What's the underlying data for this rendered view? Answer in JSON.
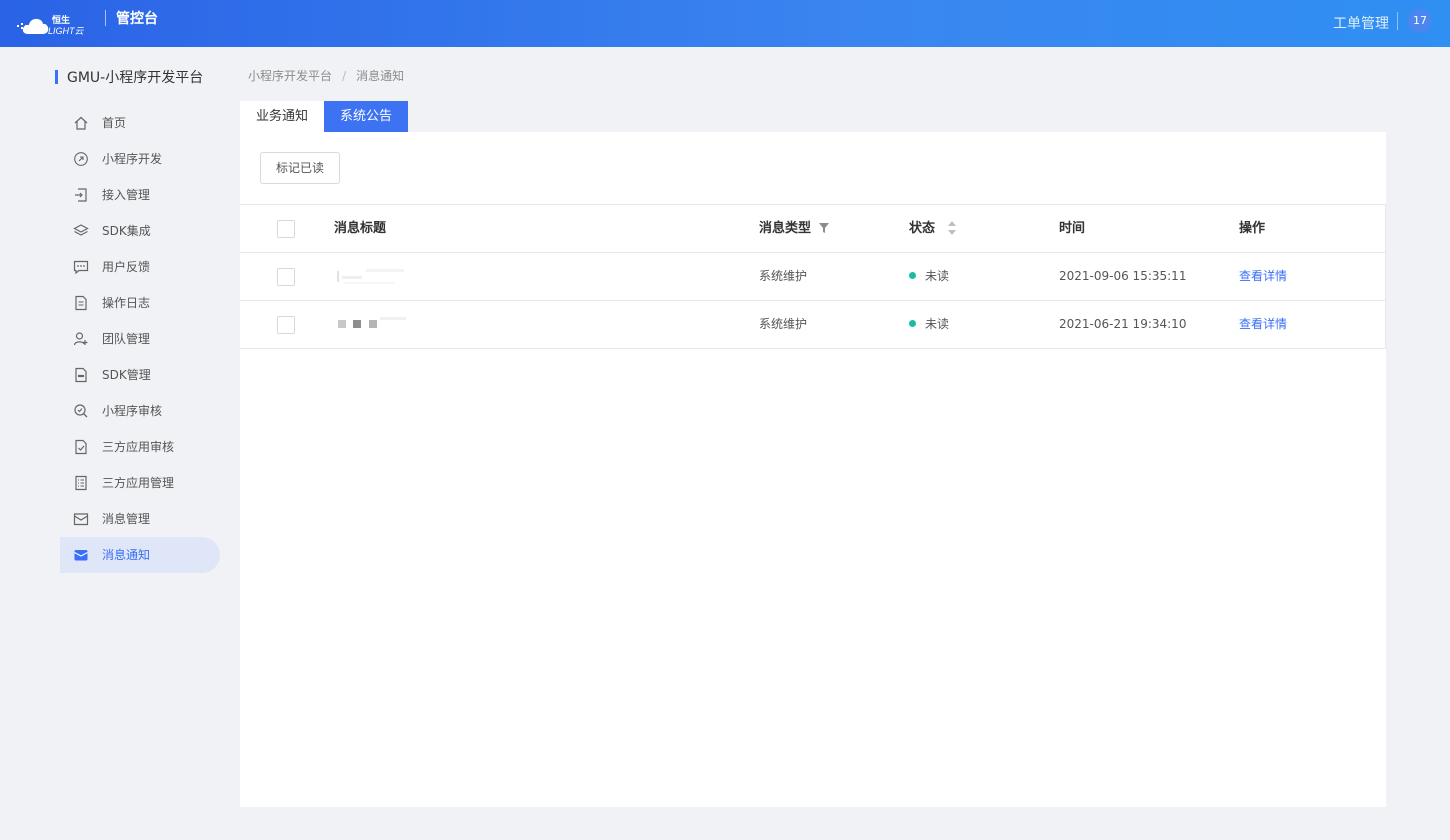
{
  "header": {
    "logo_top_text": "恒生",
    "logo_bottom_text": "LIGHT云",
    "console_title": "管控台",
    "ticket_link": "工单管理",
    "avatar_text": "17"
  },
  "sidebar": {
    "app_title": "GMU-小程序开发平台",
    "items": [
      {
        "label": "首页",
        "icon": "home-icon"
      },
      {
        "label": "小程序开发",
        "icon": "link-icon"
      },
      {
        "label": "接入管理",
        "icon": "login-icon"
      },
      {
        "label": "SDK集成",
        "icon": "layers-icon"
      },
      {
        "label": "用户反馈",
        "icon": "chat-icon"
      },
      {
        "label": "操作日志",
        "icon": "document-icon"
      },
      {
        "label": "团队管理",
        "icon": "user-add-icon"
      },
      {
        "label": "SDK管理",
        "icon": "sdk-file-icon"
      },
      {
        "label": "小程序审核",
        "icon": "audit-search-icon"
      },
      {
        "label": "三方应用审核",
        "icon": "check-file-icon"
      },
      {
        "label": "三方应用管理",
        "icon": "list-file-icon"
      },
      {
        "label": "消息管理",
        "icon": "mailbox-icon"
      },
      {
        "label": "消息通知",
        "icon": "mail-icon",
        "active": true
      }
    ]
  },
  "breadcrumb": {
    "items": [
      "小程序开发平台",
      "消息通知"
    ],
    "separator": "/"
  },
  "tabs": [
    {
      "label": "业务通知",
      "active": false
    },
    {
      "label": "系统公告",
      "active": true
    }
  ],
  "toolbar": {
    "mark_read_label": "标记已读"
  },
  "table": {
    "columns": {
      "title": "消息标题",
      "type": "消息类型",
      "status": "状态",
      "time": "时间",
      "action": "操作"
    },
    "rows": [
      {
        "type": "系统维护",
        "status": "未读",
        "time": "2021-09-06 15:35:11",
        "action": "查看详情"
      },
      {
        "type": "系统维护",
        "status": "未读",
        "time": "2021-06-21 19:34:10",
        "action": "查看详情"
      }
    ]
  },
  "colors": {
    "accent": "#3a6ff7",
    "status_unread": "#19be9f",
    "header_gradient_start": "#2a63e6",
    "header_gradient_end": "#2f8ff2"
  }
}
